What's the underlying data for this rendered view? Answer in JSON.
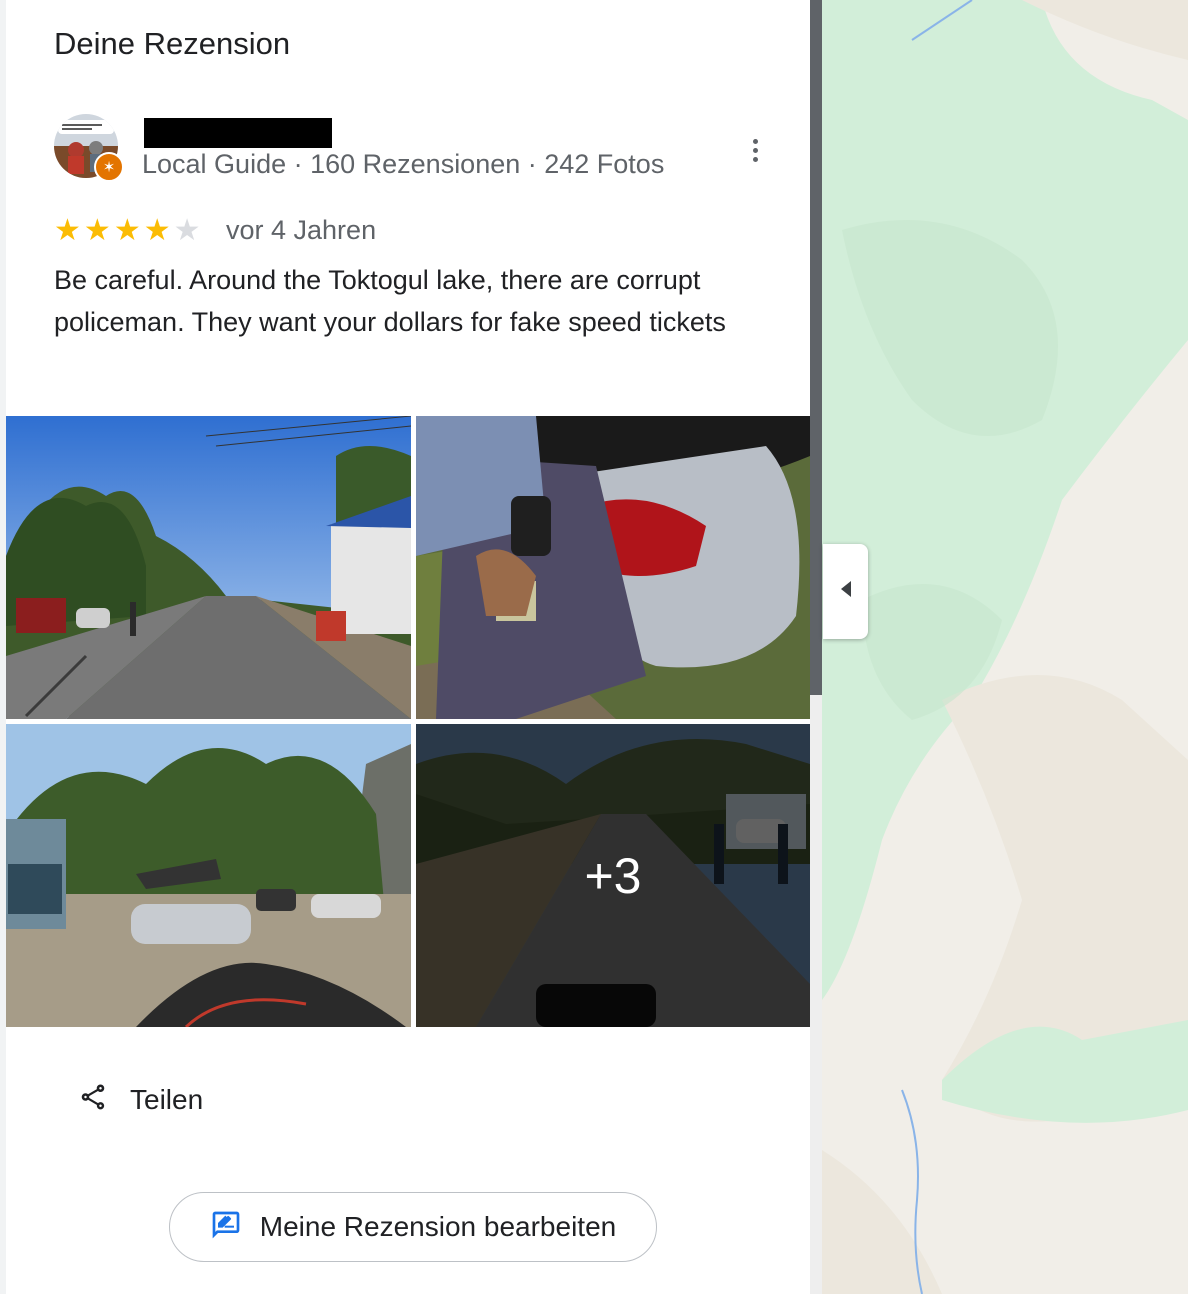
{
  "section": {
    "title": "Deine Rezension"
  },
  "reviewer": {
    "name": "K███████",
    "meta": "Local Guide · 160 Rezensionen · 242 Fotos",
    "avatar_icon": "cartoon-avatar",
    "badge_icon": "local-guide-star-icon"
  },
  "review": {
    "rating": 4,
    "max_rating": 5,
    "date": "vor 4 Jahren",
    "text": "Be careful. Around the Toktogul lake, there are corrupt policeman. They want your dollars for fake speed tickets"
  },
  "photos": {
    "items": [
      "checkpoint-road-photo",
      "policeman-car-photo",
      "parking-area-photo",
      "road-police-photo"
    ],
    "more_label": "+3"
  },
  "actions": {
    "share_label": "Teilen",
    "share_icon": "share-icon",
    "edit_label": "Meine Rezension bearbeiten",
    "edit_icon": "rate-review-icon",
    "more_icon": "more-vert-icon",
    "collapse_icon": "chevron-left-icon"
  },
  "colors": {
    "star_on": "#fbbc04",
    "star_off": "#dadce0",
    "accent": "#1a73e8",
    "badge": "#e37400",
    "map_green": "#d2eed9",
    "map_beige": "#f1eee8"
  }
}
